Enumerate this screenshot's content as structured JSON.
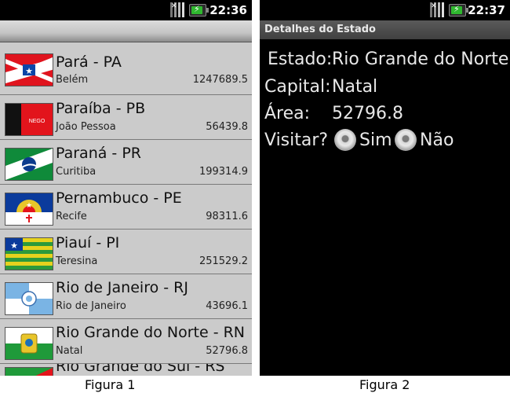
{
  "phone1": {
    "status": {
      "time": "22:36"
    },
    "states": [
      {
        "name": "Pará - PA",
        "capital": "Belém",
        "area": "1247689.5",
        "flag_icon": "para-flag-icon"
      },
      {
        "name": "Paraíba - PB",
        "capital": "João Pessoa",
        "area": "56439.8",
        "flag_icon": "paraiba-flag-icon",
        "flag_text": "NEGO"
      },
      {
        "name": "Paraná - PR",
        "capital": "Curitiba",
        "area": "199314.9",
        "flag_icon": "parana-flag-icon"
      },
      {
        "name": "Pernambuco - PE",
        "capital": "Recife",
        "area": "98311.6",
        "flag_icon": "pernambuco-flag-icon"
      },
      {
        "name": "Piauí - PI",
        "capital": "Teresina",
        "area": "251529.2",
        "flag_icon": "piaui-flag-icon"
      },
      {
        "name": "Rio de Janeiro - RJ",
        "capital": "Rio de Janeiro",
        "area": "43696.1",
        "flag_icon": "rio-de-janeiro-flag-icon"
      },
      {
        "name": "Rio Grande do Norte - RN",
        "capital": "Natal",
        "area": "52796.8",
        "flag_icon": "rio-grande-do-norte-flag-icon"
      },
      {
        "name": "Rio Grande do Sul - RS",
        "capital": "",
        "area": "",
        "flag_icon": "rio-grande-do-sul-flag-icon"
      }
    ]
  },
  "phone2": {
    "status": {
      "time": "22:37"
    },
    "title": "Detalhes do Estado",
    "labels": {
      "estado": "Estado:",
      "capital": "Capital:",
      "area": "Área:",
      "visitar": "Visitar?"
    },
    "values": {
      "estado": "Rio Grande do Norte",
      "capital": "Natal",
      "area": "52796.8"
    },
    "options": {
      "yes": "Sim",
      "no": "Não"
    }
  },
  "captions": {
    "figure1": "Figura 1",
    "figure2": "Figura 2"
  }
}
